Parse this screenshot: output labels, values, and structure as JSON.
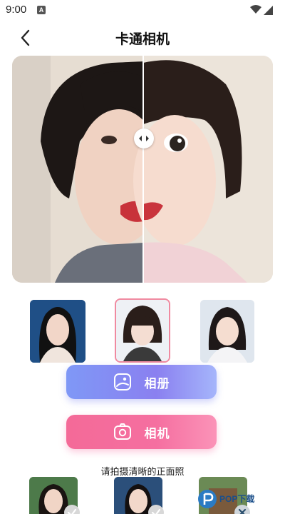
{
  "status_bar": {
    "time": "9:00",
    "notification_letter": "A"
  },
  "header": {
    "title": "卡通相机"
  },
  "compare": {},
  "templates": [
    {
      "name": "template-1"
    },
    {
      "name": "template-2"
    },
    {
      "name": "template-3"
    }
  ],
  "buttons": {
    "album_label": "相册",
    "camera_label": "相机"
  },
  "hint": {
    "text": "请拍摄清晰的正面照"
  },
  "samples": [
    {
      "status": "ok"
    },
    {
      "status": "ok"
    },
    {
      "status": "bad"
    }
  ],
  "watermark": {
    "text": "POP下载"
  },
  "colors": {
    "album_button": "#8a8ef3",
    "camera_button": "#f56fa0",
    "selected_border": "#f08aa0"
  }
}
